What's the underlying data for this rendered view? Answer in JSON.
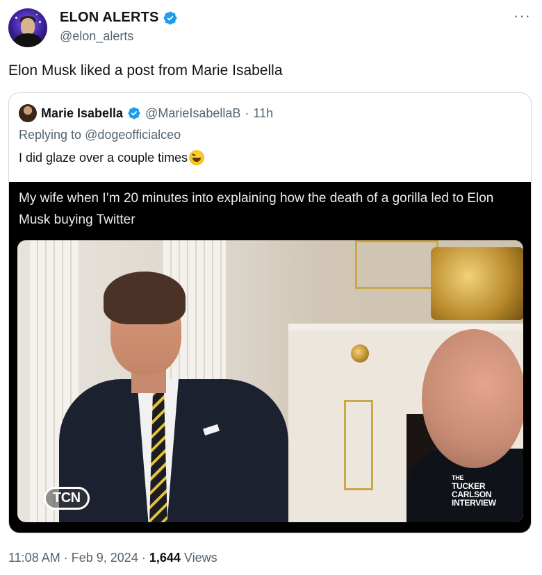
{
  "author": {
    "display_name": "ELON ALERTS",
    "handle": "@elon_alerts",
    "avatar_icon": "avatar-image",
    "verified_icon": "verified-badge-icon",
    "verified_color": "#1d9bf0"
  },
  "menu": {
    "more_label": "···"
  },
  "tweet": {
    "text": "Elon Musk liked a post from Marie Isabella"
  },
  "quoted": {
    "display_name": "Marie Isabella",
    "handle": "@MarieIsabellaB",
    "separator": "·",
    "time": "11h",
    "replying_prefix": "Replying to",
    "replying_to": "@dogeofficialceo",
    "text": "I did glaze over a couple times",
    "emoji_icon": "grinning-squinting-face-emoji",
    "media": {
      "caption": "My wife when I’m 20 minutes into explaining how the death of a gorilla led to Elon Musk buying Twitter",
      "logo_left": "TCN",
      "logo_right_lines": [
        "THE",
        "TUCKER",
        "CARLSON",
        "INTERVIEW"
      ]
    }
  },
  "meta": {
    "time": "11:08 AM",
    "sep1": "·",
    "date": "Feb 9, 2024",
    "sep2": "·",
    "views_count": "1,644",
    "views_label": "Views"
  },
  "colors": {
    "text_primary": "#0f1419",
    "text_secondary": "#536471",
    "border": "#cfd9de",
    "accent": "#1d9bf0"
  }
}
